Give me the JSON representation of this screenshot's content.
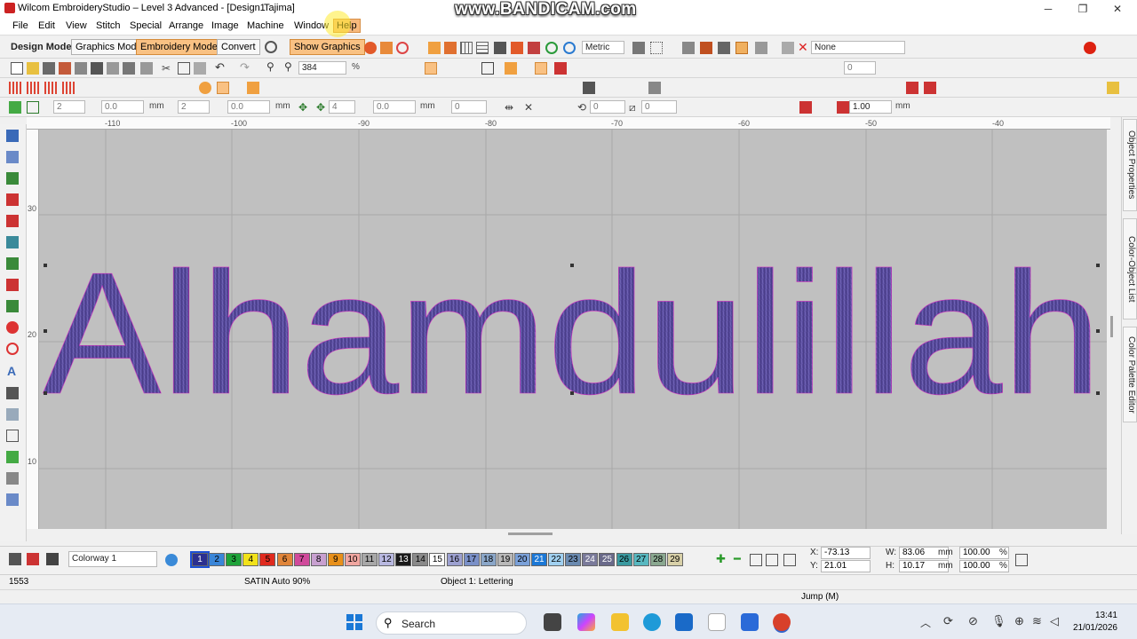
{
  "titlebar": {
    "title": "Wilcom EmbroideryStudio – Level 3 Advanced - [Design1",
    "title_suffix": "Tajima]",
    "watermark": "www.BANDICAM.com"
  },
  "menu": {
    "items": [
      "File",
      "Edit",
      "View",
      "Stitch",
      "Special",
      "Arrange",
      "Image",
      "Machine",
      "Window",
      "Help"
    ]
  },
  "toolbar1": {
    "design_mode_label": "Design Mode:",
    "graphics_mode": "Graphics Mode",
    "embroidery_mode": "Embroidery Mode",
    "convert": "Convert",
    "show_graphics": "Show Graphics",
    "units": "Metric",
    "none_label": "None"
  },
  "toolbar2": {
    "zoom": "384",
    "field_zero": "0"
  },
  "toolbar3": {
    "f_2a": "2",
    "f_00a": "0.0",
    "mm_a": "mm",
    "f_2b": "2",
    "f_00b": "0.0",
    "mm_b": "mm",
    "f_4": "4",
    "f_00c": "0.0",
    "mm_c": "mm",
    "f_0a": "0",
    "f_0b": "0",
    "f_0c": "0",
    "f_100": "1.00",
    "mm_d": "mm"
  },
  "ruler": {
    "top": [
      "-110",
      "-100",
      "-90",
      "-80",
      "-70",
      "-60",
      "-50",
      "-40"
    ],
    "left": [
      "30",
      "20",
      "10"
    ]
  },
  "canvas": {
    "lettering": "Alhamdulillah",
    "thread_color": "#55489a",
    "background": "#c0c0c0"
  },
  "right_tabs": [
    "Object Properties",
    "Color-Object List",
    "Color Palette Editor"
  ],
  "colorbar": {
    "colorway": "Colorway 1",
    "swatches": [
      {
        "n": "1",
        "c": "#2b2f8f"
      },
      {
        "n": "2",
        "c": "#3a86d8"
      },
      {
        "n": "3",
        "c": "#1fa33a"
      },
      {
        "n": "4",
        "c": "#f2e21a"
      },
      {
        "n": "5",
        "c": "#e02a1e"
      },
      {
        "n": "6",
        "c": "#e0853a"
      },
      {
        "n": "7",
        "c": "#d04a9b"
      },
      {
        "n": "8",
        "c": "#c8a0d0"
      },
      {
        "n": "9",
        "c": "#e8901a"
      },
      {
        "n": "10",
        "c": "#f0a6a0"
      },
      {
        "n": "11",
        "c": "#a8a8a8"
      },
      {
        "n": "12",
        "c": "#b8b8e0"
      },
      {
        "n": "13",
        "c": "#1a1a1a"
      },
      {
        "n": "14",
        "c": "#8a8a8a"
      },
      {
        "n": "15",
        "c": "#ffffff"
      },
      {
        "n": "16",
        "c": "#9ca0d0"
      },
      {
        "n": "17",
        "c": "#7a90c8"
      },
      {
        "n": "18",
        "c": "#8aa6c8"
      },
      {
        "n": "19",
        "c": "#b8b8b8"
      },
      {
        "n": "20",
        "c": "#7aa0d8"
      },
      {
        "n": "21",
        "c": "#1c78d6"
      },
      {
        "n": "22",
        "c": "#a0d0f0"
      },
      {
        "n": "23",
        "c": "#6a8ab0"
      },
      {
        "n": "24",
        "c": "#7a7a9a"
      },
      {
        "n": "25",
        "c": "#6a6a8a"
      },
      {
        "n": "26",
        "c": "#3a9aa0"
      },
      {
        "n": "27",
        "c": "#58b8c0"
      },
      {
        "n": "28",
        "c": "#8aa890"
      },
      {
        "n": "29",
        "c": "#d8d0a8"
      }
    ],
    "x_label": "X:",
    "x_val": "-73.13",
    "y_label": "Y:",
    "y_val": "21.01",
    "w_label": "W:",
    "w_val": "83.06",
    "h_label": "H:",
    "h_val": "10.17",
    "unit_mm": "mm",
    "pct_w": "100.00",
    "pct_h": "100.00",
    "pct": "%"
  },
  "status": {
    "stitch_count": "1553",
    "stitch_type": "SATIN Auto 90%",
    "object": "Object 1: Lettering",
    "jump": "Jump (M)"
  },
  "taskbar": {
    "search": "Search",
    "time": "13:41",
    "date": "21/01/2026"
  }
}
